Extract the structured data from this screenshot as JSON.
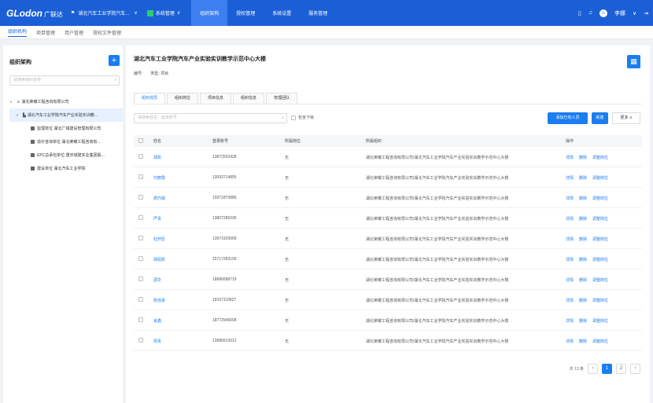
{
  "topbar": {
    "logo": "GLodon",
    "logo_cn": "广联达",
    "project": "湖北汽车工业学院汽车...",
    "system": "系统管理",
    "nav": [
      "组织架构",
      "授权管理",
      "系统设置",
      "服务管理"
    ],
    "user": "李娜"
  },
  "subnav": [
    "组织机构",
    "项目管理",
    "用户管理",
    "授权文件管理"
  ],
  "left": {
    "title": "组织架构",
    "add": "+",
    "search_placeholder": "请搜索组织名称",
    "tree": [
      {
        "label": "湖北荣耀工程咨询有限公司",
        "level": 0,
        "toggle": "∨"
      },
      {
        "label": "湖北汽车工业学院汽车产业实验实训教...",
        "level": 1,
        "toggle": "∨"
      },
      {
        "label": "监理单位 湖北广域建设管理有限公司",
        "level": 2
      },
      {
        "label": "造价咨询单位 湖北荣耀工程咨询有...",
        "level": 2
      },
      {
        "label": "EPC总承包单位 重庆城建实业集团股...",
        "level": 2
      },
      {
        "label": "建设单位 湖北汽车工业学院",
        "level": 2
      }
    ]
  },
  "main": {
    "title": "湖北汽车工业学院汽车产业实验实训教学示范中心大楼",
    "code_label": "编号:",
    "type_label": "类型:",
    "type_value": "项目",
    "tabs": [
      "组织成员",
      "组织岗位",
      "项目信息",
      "组织信息",
      "管理团队"
    ],
    "search_placeholder": "请搜索姓名、登录账号",
    "include_sub": "包含下级",
    "btn_add_member": "添加已有人员",
    "btn_new": "新建",
    "btn_more": "更多 ∨",
    "columns": [
      "姓名",
      "登录账号",
      "所属岗位",
      "所属组织",
      "操作"
    ],
    "actions": [
      "详情",
      "删除",
      "调整岗位"
    ],
    "rows": [
      {
        "name": "郑凯",
        "account": "13872502428",
        "post": "无",
        "org": "湖北荣耀工程咨询有限公司/湖北汽车工业学院汽车产业实验实训教学示范中心大楼"
      },
      {
        "name": "刘丽霞",
        "account": "13593714855",
        "post": "无",
        "org": "湖北荣耀工程咨询有限公司/湖北汽车工业学院汽车产业实验实训教学示范中心大楼"
      },
      {
        "name": "唐巧娟",
        "account": "15971870886",
        "post": "无",
        "org": "湖北荣耀工程咨询有限公司/湖北汽车工业学院汽车产业实验实训教学示范中心大楼"
      },
      {
        "name": "严青",
        "account": "13807286335",
        "post": "无",
        "org": "湖北荣耀工程咨询有限公司/湖北汽车工业学院汽车产业实验实训教学示范中心大楼"
      },
      {
        "name": "杜轩臣",
        "account": "13971925669",
        "post": "无",
        "org": "湖北荣耀工程咨询有限公司/湖北汽车工业学院汽车产业实验实训教学示范中心大楼"
      },
      {
        "name": "郑绍凯",
        "account": "15717283100",
        "post": "无",
        "org": "湖北荣耀工程咨询有限公司/湖北汽车工业学院汽车产业实验实训教学示范中心大楼"
      },
      {
        "name": "邵华",
        "account": "18986688719",
        "post": "无",
        "org": "湖北荣耀工程咨询有限公司/湖北汽车工业学院汽车产业实验实训教学示范中心大楼"
      },
      {
        "name": "陈佳豪",
        "account": "18107110827",
        "post": "无",
        "org": "湖北荣耀工程咨询有限公司/湖北汽车工业学院汽车产业实验实训教学示范中心大楼"
      },
      {
        "name": "肖鑫",
        "account": "18772945008",
        "post": "无",
        "org": "湖北荣耀工程咨询有限公司/湖北汽车工业学院汽车产业实验实训教学示范中心大楼"
      },
      {
        "name": "周青",
        "account": "13986912012",
        "post": "无",
        "org": "湖北荣耀工程咨询有限公司/湖北汽车工业学院汽车产业实验实训教学示范中心大楼"
      }
    ],
    "pager": {
      "total": "共 13 条",
      "prev": "‹",
      "pages": [
        "1",
        "2"
      ],
      "next": "›"
    }
  }
}
